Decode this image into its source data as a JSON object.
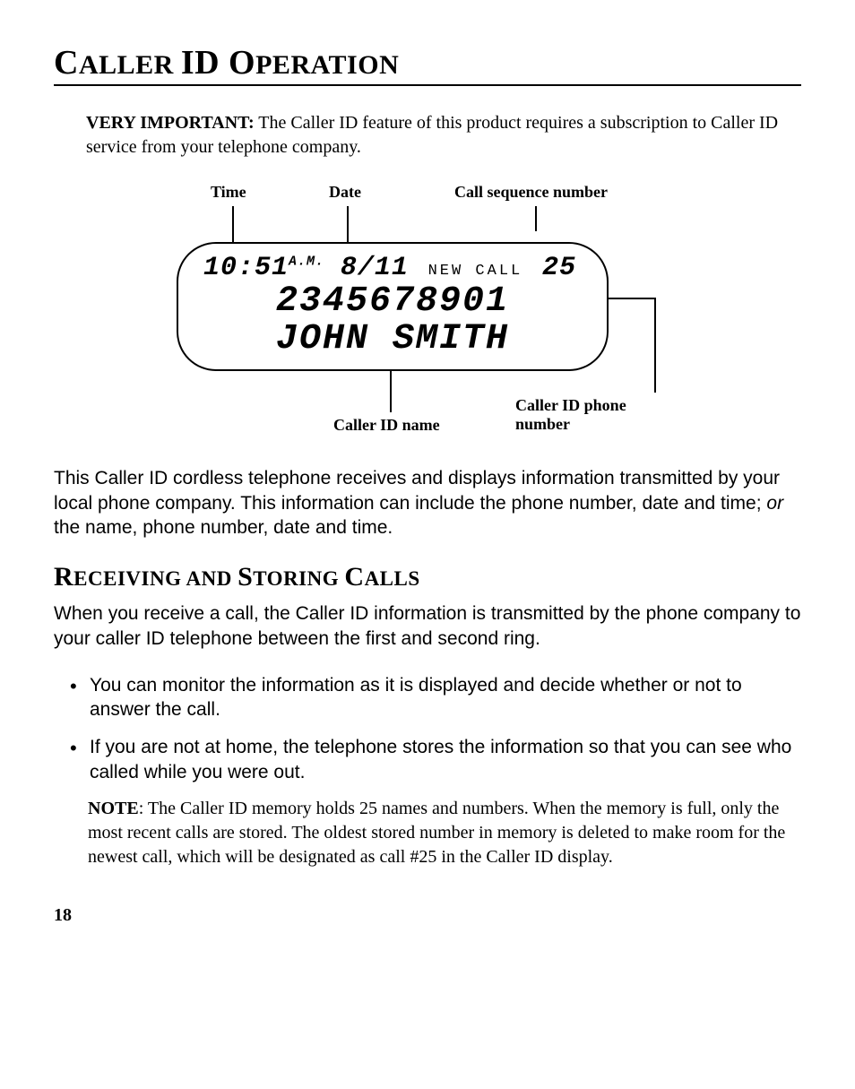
{
  "title": {
    "c1": "C",
    "r1": "ALLER ",
    "i1": "ID ",
    "o1": "O",
    "r2": "PERATION"
  },
  "intro": {
    "bold": "VERY IMPORTANT:",
    "rest": " The Caller ID feature of this product requires a subscription to Caller ID service from your telephone company."
  },
  "diagram": {
    "label_time": "Time",
    "label_date": "Date",
    "label_seq": "Call sequence number",
    "lcd": {
      "time": "10:51",
      "ampm": "A.M.",
      "date": "8/11",
      "flag": "NEW  CALL",
      "seq": "25",
      "number": "2345678901",
      "name": "JOHN SMITH"
    },
    "label_name": "Caller ID name",
    "label_phone": "Caller ID phone number"
  },
  "para1_a": "This Caller ID cordless telephone receives and displays information transmitted by your local phone company. This information can include the phone number, date and time; ",
  "para1_em": "or",
  "para1_b": " the name, phone number, date and time.",
  "section": {
    "r1": "R",
    "r1s": "ECEIVING ",
    "a1": "AND ",
    "s1": "S",
    "s1s": "TORING ",
    "c1": "C",
    "c1s": "ALLS"
  },
  "para2": "When you receive a call, the Caller ID information is transmitted by the phone company to your caller ID telephone between the first and second ring.",
  "bullets": [
    "You can monitor the information as it is displayed and decide whether or not to answer the call.",
    "If you are not at home, the telephone stores the information so that you can see who called while you were out."
  ],
  "note": {
    "bold": "NOTE",
    "rest": ": The Caller ID memory holds 25 names and numbers. When the memory is full, only the most recent calls are stored. The oldest stored number in memory is deleted to make room for the newest call, which will be designated as call #25 in the Caller ID display."
  },
  "pagenum": "18"
}
